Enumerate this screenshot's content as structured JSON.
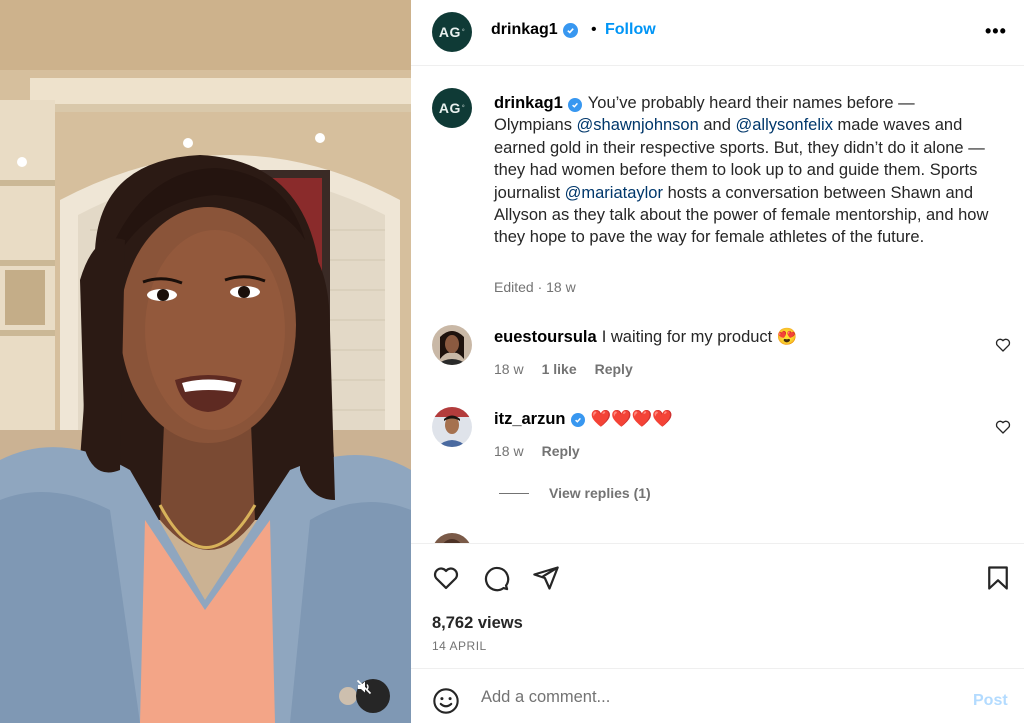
{
  "post": {
    "username": "drinkag1",
    "avatar_text": "AG",
    "follow_label": "Follow",
    "separator": "•",
    "more_label": "•••",
    "caption": {
      "segments": [
        "You’ve probably heard their names before — Olympians ",
        "@shawnjohnson",
        " and ",
        "@allysonfelix",
        " made waves and earned gold in their respective sports. But, they didn’t do it alone — they had women before them to look up to and guide them. Sports journalist ",
        "@mariataylor",
        " hosts a conversation between Shawn and Allyson as they talk about the power of female mentorship, and how they hope to pave the way for female athletes of the future."
      ],
      "meta": "Edited · 18 w"
    },
    "views": "8,762 views",
    "date": "14 APRIL"
  },
  "comments": [
    {
      "username": "euestoursula",
      "text": "I waiting for my product 😍",
      "time": "18 w",
      "likes": "1 like",
      "reply": "Reply"
    },
    {
      "username": "itz_arzun",
      "text": "❤️❤️❤️❤️",
      "time": "18 w",
      "reply": "Reply",
      "view_replies": "View replies (1)"
    }
  ],
  "add_comment": {
    "placeholder": "Add a comment...",
    "post_label": "Post"
  },
  "icons": {
    "verified": "verified-badge-icon",
    "heart": "heart-icon",
    "comment": "comment-icon",
    "share": "paper-plane-icon",
    "save": "bookmark-icon",
    "emoji": "smiley-icon",
    "mute": "speaker-muted-icon"
  },
  "colors": {
    "link": "#0095f6",
    "mention": "#00376b",
    "verified": "#3897f0",
    "muted_text": "#737373",
    "post_disabled": "#b3dbff"
  }
}
